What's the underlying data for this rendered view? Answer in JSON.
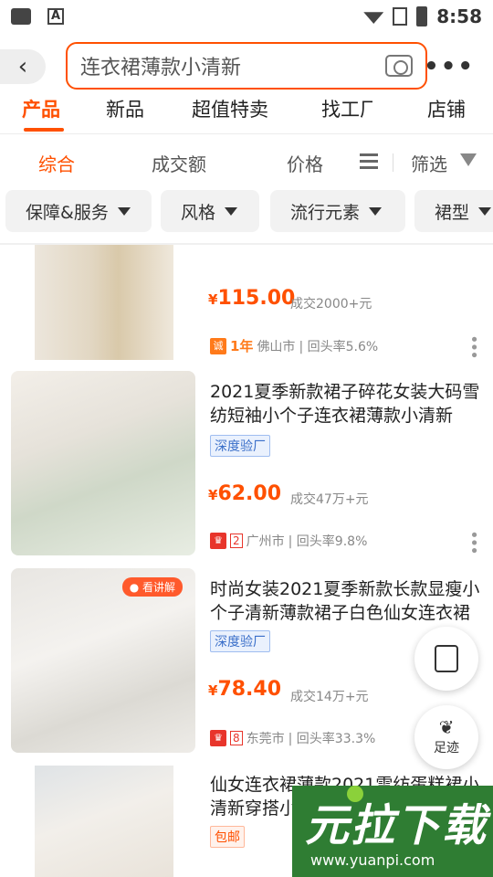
{
  "status_bar": {
    "time": "8:58",
    "a_icon_label": "A"
  },
  "search": {
    "query": "连衣裙薄款小清新"
  },
  "more_label": "•••",
  "category_tabs": [
    "产品",
    "新品",
    "超值特卖",
    "找工厂",
    "店铺"
  ],
  "sort_options": {
    "comprehensive": "综合",
    "sales": "成交额",
    "price": "价格",
    "filter": "筛选"
  },
  "filter_chips": [
    "保障&服务",
    "风格",
    "流行元素",
    "裙型"
  ],
  "products": [
    {
      "price_symbol": "¥",
      "price": "115.00",
      "sold": "成交2000+元",
      "year": "1年",
      "city": "佛山市",
      "repurchase": "| 回头率5.6%"
    },
    {
      "title": "2021夏季新款裙子碎花女装大码雪纺短袖小个子连衣裙薄款小清新",
      "badge": "深度验厂",
      "price_symbol": "¥",
      "price": "62.00",
      "sold": "成交47万+元",
      "level": "2",
      "city": "广州市",
      "repurchase": "| 回头率9.8%"
    },
    {
      "title": "时尚女装2021夏季新款长款显瘦小个子清新薄款裙子白色仙女连衣裙",
      "badge": "深度验厂",
      "thumb_tag": "看讲解",
      "price_symbol": "¥",
      "price": "78.40",
      "sold": "成交14万+元",
      "level": "8",
      "city": "东莞市",
      "repurchase": "| 回头率33.3%"
    },
    {
      "title": "仙女连衣裙薄款2021雪纺蛋糕裙小清新穿搭小个子显高显瘦款",
      "badge": "包邮"
    }
  ],
  "fab": {
    "footprint_label": "足迹"
  },
  "watermark": {
    "big": "元拉下载",
    "small": "www.yuanpi.com"
  },
  "colors": {
    "accent": "#ff5000",
    "badge_blue": "#3a6fc9"
  }
}
